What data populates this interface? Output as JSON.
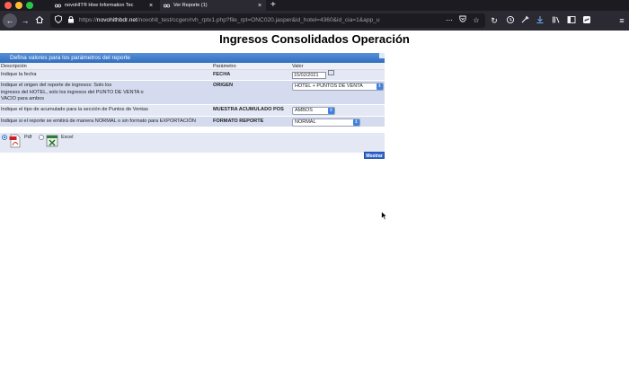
{
  "browser": {
    "tabs": [
      {
        "title": "novoHIT® Hive Information Tec"
      },
      {
        "title": "Ver Reporte (1)"
      }
    ],
    "url": {
      "prefix": "https://",
      "domain": "novohithbdr.net",
      "path": "/novohit_test/ccgen/rvh_rptx1.php?file_rpt=ONC020.jasper&id_hotel=4360&id_cia=1&app_u"
    },
    "icons": [
      "back-icon",
      "forward-icon",
      "home-icon",
      "shield-icon",
      "lock-icon",
      "more-icon",
      "pocket-icon",
      "star-icon",
      "reload-icon",
      "history-icon",
      "tools-icon",
      "download-icon",
      "library-icon",
      "sidebar-icon",
      "extension-icon",
      "menu-icon"
    ]
  },
  "page": {
    "title": "Ingresos Consolidados Operación"
  },
  "panel": {
    "header": "Defina valores para los parámetros del reporte",
    "columns": {
      "descripcion": "Descripción",
      "parametro": "Parámetro",
      "valor": "Valor"
    },
    "rows": [
      {
        "description": "Indique la fecha",
        "param": "FECHA",
        "value": "15/02/2021"
      },
      {
        "description_lines": [
          "Indique el origen del reporte de ingresos: Solo los",
          "ingresos del HOTEL, solo los ingresos del PUNTO DE VENTA o",
          "VACIO para ambos"
        ],
        "param": "ORIGEN",
        "value": "HOTEL + PUNTOS DE VENTA"
      },
      {
        "description": "Indique el tipo de acumulado para la sección de Puntos de Ventas",
        "param": "MUESTRA ACUMULADO POS",
        "value": "AMBOS"
      },
      {
        "description": "Indique si el reporte se emitirá de manera NORMAL o sin formato para EXPORTACIÓN",
        "param": "FORMATO REPORTE",
        "value": "NORMAL"
      }
    ],
    "format_options": [
      {
        "label": "Pdf",
        "checked": true
      },
      {
        "label": "Excel",
        "checked": false
      }
    ],
    "submit_label": "Mostrar"
  },
  "colors": {
    "panel_header": "#2f6ec1",
    "row_light": "#e3e8f4",
    "row_dark": "#d5dbee",
    "button": "#3366cc"
  }
}
